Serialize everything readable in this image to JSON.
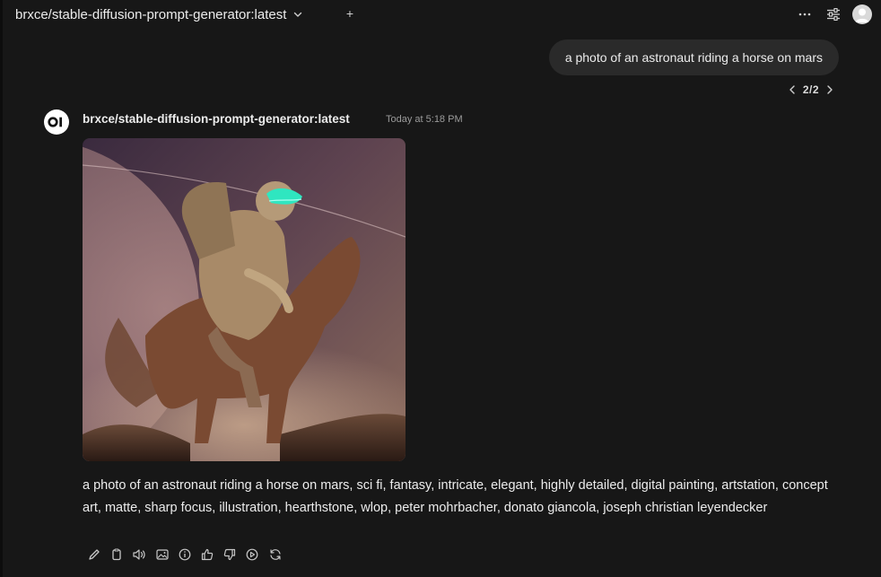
{
  "header": {
    "model_name": "brxce/stable-diffusion-prompt-generator:latest",
    "add_label": "+"
  },
  "user_message": {
    "text": "a photo of an astronaut riding a horse on mars"
  },
  "pager": {
    "text": "2/2"
  },
  "assistant": {
    "name": "brxce/stable-diffusion-prompt-generator:latest",
    "timestamp": "Today at 5:18 PM",
    "logo_text": "OI",
    "response": "a photo of an astronaut riding a horse on mars, sci fi, fantasy, intricate, elegant, highly detailed, digital painting, artstation, concept art, matte, sharp focus, illustration, hearthstone, wlop, peter mohrbacher, donato giancola, joseph christian leyendecker"
  },
  "actions": [
    "edit-icon",
    "copy-icon",
    "read-aloud-icon",
    "generate-image-icon",
    "info-icon",
    "thumbs-up-icon",
    "thumbs-down-icon",
    "continue-icon",
    "regenerate-icon"
  ],
  "colors": {
    "background": "#171717",
    "bubble": "#2a2a2a",
    "text": "#ececec",
    "muted": "#9b9b9b"
  }
}
